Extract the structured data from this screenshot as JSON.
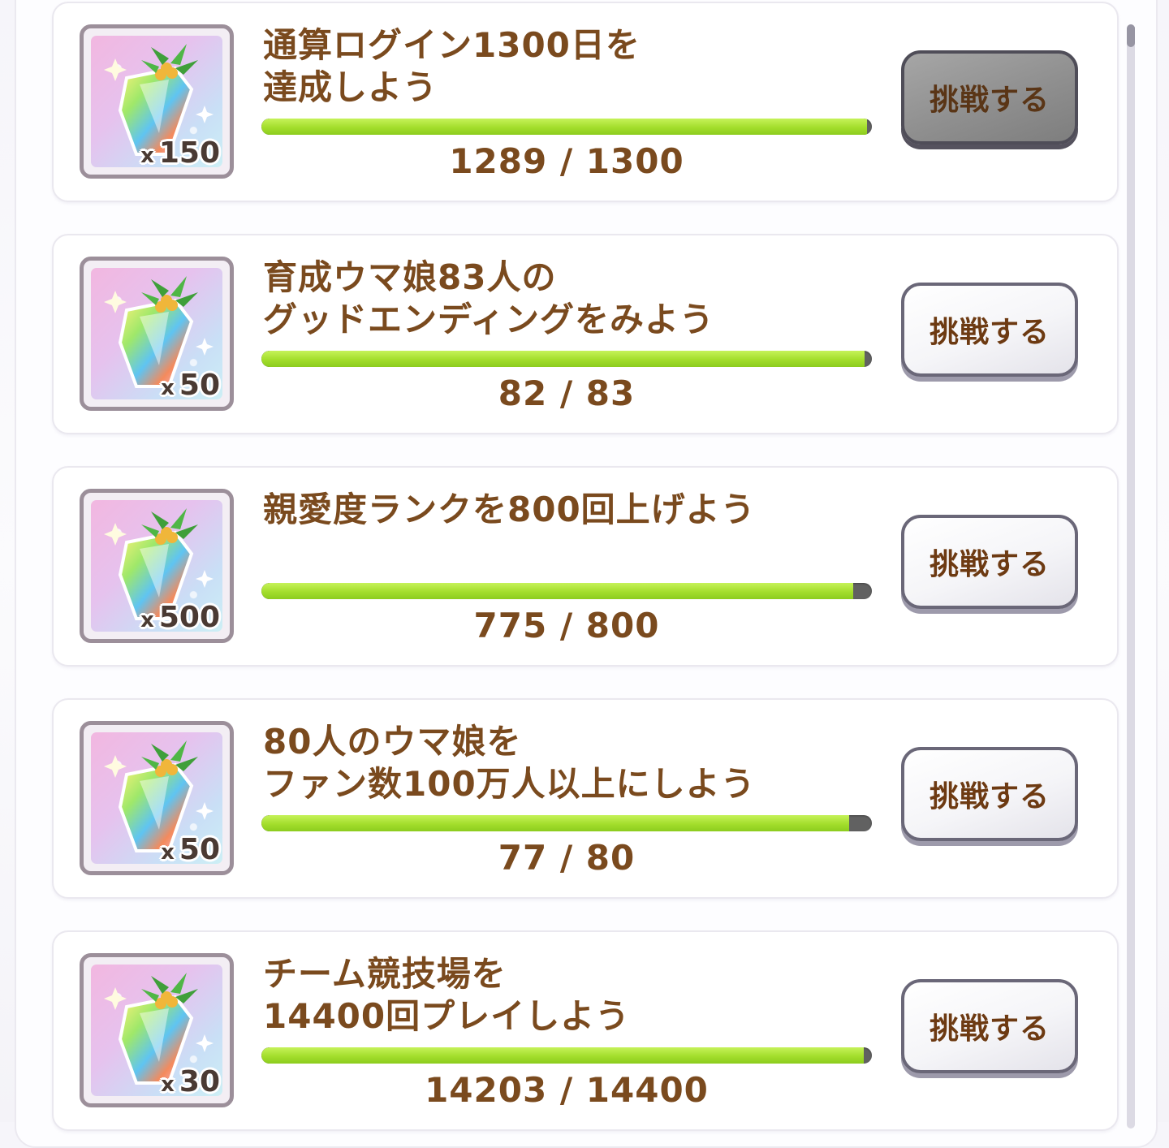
{
  "button_label": "挑戦する",
  "reward_icon": "carrot-jewel-icon",
  "missions": [
    {
      "title_lines": [
        "通算ログイン1300日を",
        "達成しよう"
      ],
      "reward_prefix": "x",
      "reward_qty": "150",
      "current": 1289,
      "target": 1300,
      "progress_text": "1289 / 1300",
      "button_state": "dimmed"
    },
    {
      "title_lines": [
        "育成ウマ娘83人の",
        "グッドエンディングをみよう"
      ],
      "reward_prefix": "x",
      "reward_qty": "50",
      "current": 82,
      "target": 83,
      "progress_text": "82 / 83",
      "button_state": "normal"
    },
    {
      "title_lines": [
        "親愛度ランクを800回上げよう"
      ],
      "reward_prefix": "x",
      "reward_qty": "500",
      "current": 775,
      "target": 800,
      "progress_text": "775 / 800",
      "button_state": "normal"
    },
    {
      "title_lines": [
        "80人のウマ娘を",
        "ファン数100万人以上にしよう"
      ],
      "reward_prefix": "x",
      "reward_qty": "50",
      "current": 77,
      "target": 80,
      "progress_text": "77 / 80",
      "button_state": "normal"
    },
    {
      "title_lines": [
        "チーム競技場を",
        "14400回プレイしよう"
      ],
      "reward_prefix": "x",
      "reward_qty": "30",
      "current": 14203,
      "target": 14400,
      "progress_text": "14203 / 14400",
      "button_state": "normal"
    }
  ],
  "colors": {
    "text_brown": "#7a4a1e",
    "bar_fill": "#a3de2c",
    "bar_track": "#616161"
  }
}
